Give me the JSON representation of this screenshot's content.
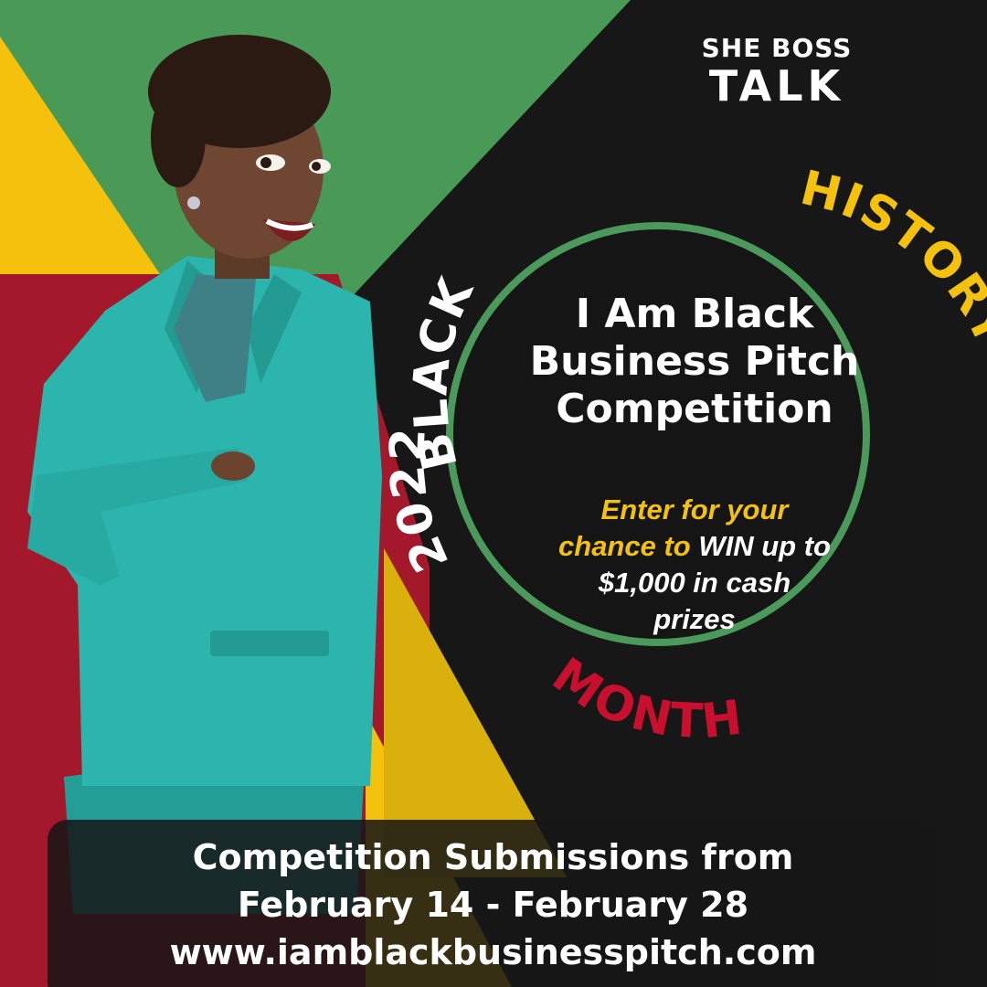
{
  "logo": {
    "line1": "SHE BOSS",
    "line2": "TALK",
    "icon": "microphone-icon"
  },
  "badge": {
    "arc_top": "BLACK",
    "arc_right": "HISTORY",
    "arc_bottom": "MONTH",
    "arc_left": "2022",
    "headline": [
      "I Am Black",
      "Business Pitch",
      "Competition"
    ],
    "promo": {
      "part1": "Enter for your",
      "part2": "chance to",
      "part3": "WIN up to",
      "part4": "$1,000 in cash",
      "part5": "prizes"
    }
  },
  "footer": {
    "line1": "Competition Submissions from",
    "line2": "February 14  - February 28",
    "line3": "www.iamblackbusinesspitch.com"
  },
  "colors": {
    "green": "#4a9a57",
    "yellow": "#f4c20d",
    "red": "#a3182a",
    "black": "#161616",
    "ring": "#4b9a5c",
    "crimson": "#c8102e",
    "suit": "#2bb5ac"
  },
  "photo": {
    "subject": "smiling-woman-in-teal-suit"
  }
}
